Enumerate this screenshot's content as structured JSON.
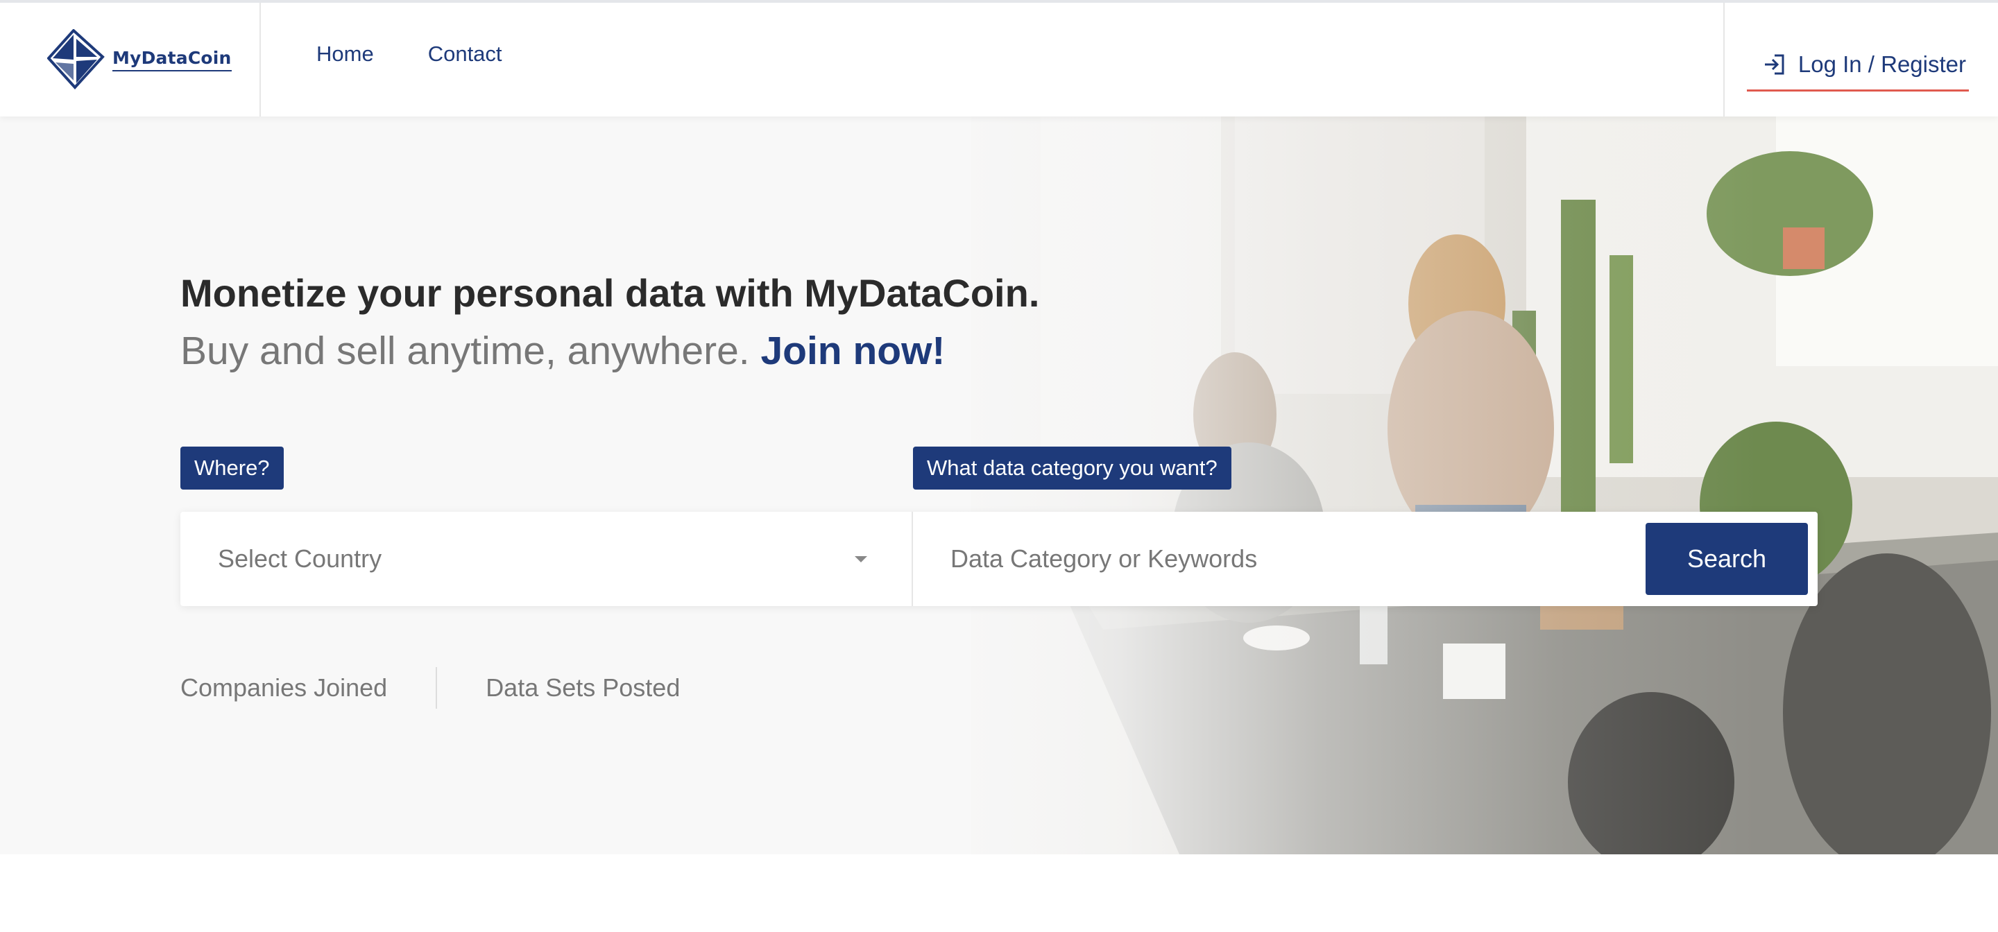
{
  "brand": {
    "name": "MyDataCoin"
  },
  "nav": {
    "items": [
      {
        "label": "Home"
      },
      {
        "label": "Contact"
      }
    ]
  },
  "auth": {
    "login_label": "Log In / Register"
  },
  "hero": {
    "headline": "Monetize your personal data with MyDataCoin.",
    "subline": "Buy and sell anytime, anywhere.",
    "join": "Join now!"
  },
  "search": {
    "where_label": "Where?",
    "category_label": "What data category you want?",
    "country_placeholder": "Select Country",
    "keyword_placeholder": "Data Category or Keywords",
    "button_label": "Search"
  },
  "stats": {
    "companies_label": "Companies Joined",
    "datasets_label": "Data Sets Posted"
  },
  "colors": {
    "brand": "#1e3a7a",
    "accent_underline": "#e05a4f"
  },
  "icons": {
    "logo": "diamond-logo-icon",
    "login": "sign-in-icon",
    "dropdown": "chevron-down-icon"
  }
}
